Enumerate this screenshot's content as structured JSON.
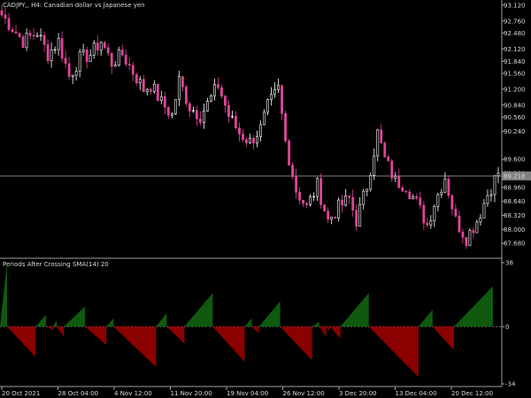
{
  "window": {
    "symbol_title": "CADJPY,, H4:  Canadian dollar vs Japanese yen",
    "indicator_title": "Periods After Crossing SMA(14) 20"
  },
  "colors": {
    "background": "#000000",
    "up_candle": "#ffffff",
    "down_candle": "#e0459a",
    "wick": "#d8d8d8",
    "bid_line": "#808080",
    "current_price_box": "#808080",
    "histogram_positive": "#0f5a0f",
    "histogram_negative": "#8b0000",
    "axis_text": "#d8d8d8"
  },
  "chart_data": [
    {
      "type": "candlestick",
      "title": "CADJPY,, H4:  Canadian dollar vs Japanese yen",
      "ylim": [
        87.4,
        93.2
      ],
      "yticks": [
        "93.120",
        "92.760",
        "92.480",
        "92.120",
        "91.840",
        "91.560",
        "91.200",
        "90.840",
        "90.560",
        "90.240",
        "89.600",
        "89.280",
        "88.960",
        "88.640",
        "88.320",
        "88.000",
        "87.680"
      ],
      "current_price": "89.218",
      "current_price_value": 89.22,
      "close_path": [
        [
          0,
          92.9
        ],
        [
          3,
          92.6
        ],
        [
          6,
          92.3
        ],
        [
          10,
          92.5
        ],
        [
          13,
          92.0
        ],
        [
          16,
          92.3
        ],
        [
          19,
          91.5
        ],
        [
          22,
          91.9
        ],
        [
          25,
          92.0
        ],
        [
          28,
          92.3
        ],
        [
          31,
          91.8
        ],
        [
          34,
          92.0
        ],
        [
          37,
          91.6
        ],
        [
          40,
          91.2
        ],
        [
          42,
          91.3
        ],
        [
          45,
          90.9
        ],
        [
          48,
          90.6
        ],
        [
          50,
          91.4
        ],
        [
          53,
          90.8
        ],
        [
          56,
          90.6
        ],
        [
          59,
          91.0
        ],
        [
          61,
          91.3
        ],
        [
          64,
          90.6
        ],
        [
          67,
          90.2
        ],
        [
          70,
          90.0
        ],
        [
          73,
          90.3
        ],
        [
          75,
          90.8
        ],
        [
          78,
          91.2
        ],
        [
          80,
          90.0
        ],
        [
          83,
          88.9
        ],
        [
          86,
          88.5
        ],
        [
          89,
          89.0
        ],
        [
          92,
          88.2
        ],
        [
          95,
          88.5
        ],
        [
          98,
          88.7
        ],
        [
          100,
          88.2
        ],
        [
          103,
          89.0
        ],
        [
          106,
          90.2
        ],
        [
          108,
          89.6
        ],
        [
          111,
          89.1
        ],
        [
          114,
          89.0
        ],
        [
          117,
          88.6
        ],
        [
          120,
          88.1
        ],
        [
          122,
          88.6
        ],
        [
          125,
          89.2
        ],
        [
          128,
          88.2
        ],
        [
          131,
          87.8
        ],
        [
          134,
          88.2
        ],
        [
          137,
          88.8
        ],
        [
          140,
          89.3
        ]
      ],
      "series": [
        {
          "name": "",
          "values": []
        }
      ]
    },
    {
      "type": "histogram",
      "title": "Periods After Crossing SMA(14) 20",
      "yticks": [
        "38",
        "0",
        "-34"
      ],
      "ylim": [
        -34,
        38
      ],
      "segments": [
        {
          "start": 0,
          "peak": 38,
          "length": 2
        },
        {
          "start": 2,
          "peak": -18,
          "length": 8
        },
        {
          "start": 10,
          "peak": 7,
          "length": 3
        },
        {
          "start": 13,
          "peak": -2,
          "length": 2
        },
        {
          "start": 15,
          "peak": 4,
          "length": 1
        },
        {
          "start": 16,
          "peak": -6,
          "length": 2
        },
        {
          "start": 18,
          "peak": 12,
          "length": 6
        },
        {
          "start": 24,
          "peak": -11,
          "length": 6
        },
        {
          "start": 30,
          "peak": 5,
          "length": 2
        },
        {
          "start": 32,
          "peak": -24,
          "length": 12
        },
        {
          "start": 44,
          "peak": 8,
          "length": 3
        },
        {
          "start": 47,
          "peak": -10,
          "length": 5
        },
        {
          "start": 52,
          "peak": 20,
          "length": 8
        },
        {
          "start": 60,
          "peak": -21,
          "length": 9
        },
        {
          "start": 69,
          "peak": 5,
          "length": 2
        },
        {
          "start": 71,
          "peak": -4,
          "length": 2
        },
        {
          "start": 73,
          "peak": 15,
          "length": 6
        },
        {
          "start": 79,
          "peak": -20,
          "length": 9
        },
        {
          "start": 88,
          "peak": 3,
          "length": 2
        },
        {
          "start": 90,
          "peak": -6,
          "length": 2
        },
        {
          "start": 92,
          "peak": -3,
          "length": 1
        },
        {
          "start": 93,
          "peak": -7,
          "length": 3
        },
        {
          "start": 96,
          "peak": 20,
          "length": 8
        },
        {
          "start": 104,
          "peak": -30,
          "length": 14
        },
        {
          "start": 118,
          "peak": 10,
          "length": 4
        },
        {
          "start": 122,
          "peak": -14,
          "length": 6
        },
        {
          "start": 128,
          "peak": 24,
          "length": 11
        }
      ]
    }
  ],
  "xaxis": {
    "ticks": [
      "20 Oct 2021",
      "28 Oct 04:00",
      "4 Nov 12:00",
      "11 Nov 20:00",
      "19 Nov 04:00",
      "26 Nov 12:00",
      "3 Dec 20:00",
      "13 Dec 04:00",
      "20 Dec 12:00"
    ]
  }
}
